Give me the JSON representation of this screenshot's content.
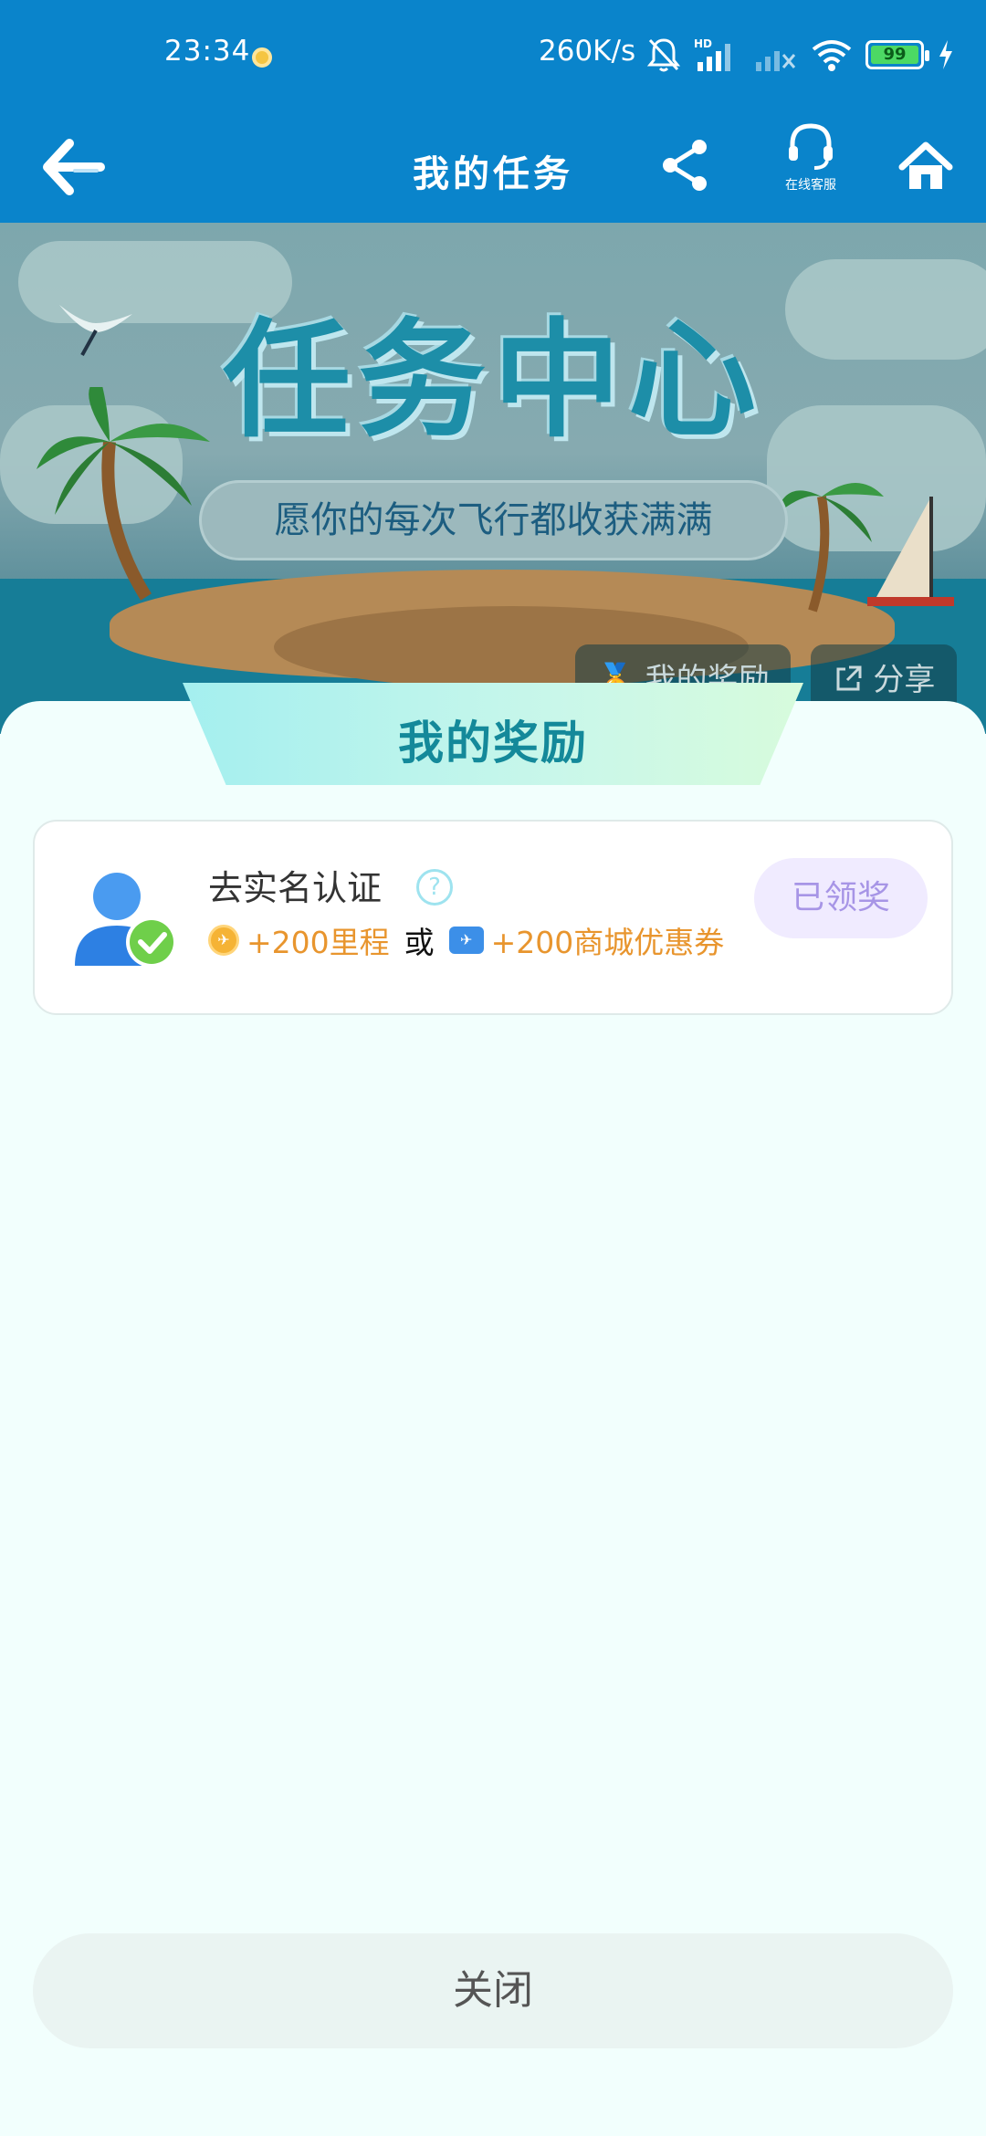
{
  "status_bar": {
    "time": "23:34",
    "net_speed": "260K/s",
    "battery": "99",
    "icons": [
      "notification-dot-icon",
      "mute-bell-icon",
      "signal-hd-icon",
      "signal-off-icon",
      "wifi-icon",
      "battery-icon",
      "charging-icon"
    ]
  },
  "nav": {
    "title": "我的任务",
    "service_label": "在线客服",
    "icons": [
      "back-arrow-icon",
      "share-icon",
      "headset-icon",
      "home-icon"
    ]
  },
  "banner": {
    "title": "任务中心",
    "subtitle": "愿你的每次飞行都收获满满",
    "rewards_button": "🏅 我的奖励",
    "share_button": "分享"
  },
  "sheet": {
    "header": "我的奖励",
    "task": {
      "title": "去实名认证",
      "help": "?",
      "mileage_reward": "+200里程",
      "or": "或",
      "coupon_reward": "+200商城优惠券",
      "status_button": "已领奖"
    },
    "close_button": "关闭"
  },
  "colors": {
    "brand_blue": "#0a84cb",
    "reward_orange": "#e8952e",
    "title_teal": "#14899a",
    "claimed_purple": "#a795e6"
  }
}
